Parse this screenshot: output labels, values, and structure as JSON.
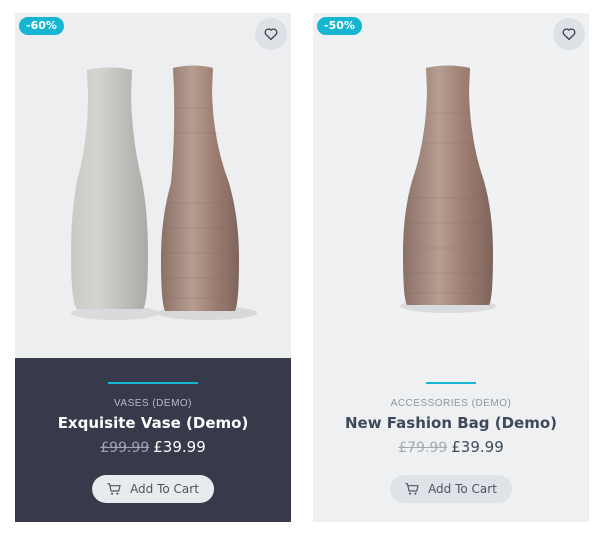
{
  "products": [
    {
      "badge": "-60%",
      "category": "VASES (DEMO)",
      "title": "Exquisite Vase (Demo)",
      "old_price": "£99.99",
      "price": "£39.99",
      "cart_label": "Add To Cart"
    },
    {
      "badge": "-50%",
      "category": "ACCESSORIES (DEMO)",
      "title": "New Fashion Bag (Demo)",
      "old_price": "£79.99",
      "price": "£39.99",
      "cart_label": "Add To Cart"
    }
  ],
  "colors": {
    "accent": "#16b6d3",
    "dark_panel": "#363a4b",
    "light_panel": "#eef0f1"
  },
  "icons": {
    "wishlist": "heart-outline-icon",
    "cart": "shopping-cart-icon"
  }
}
